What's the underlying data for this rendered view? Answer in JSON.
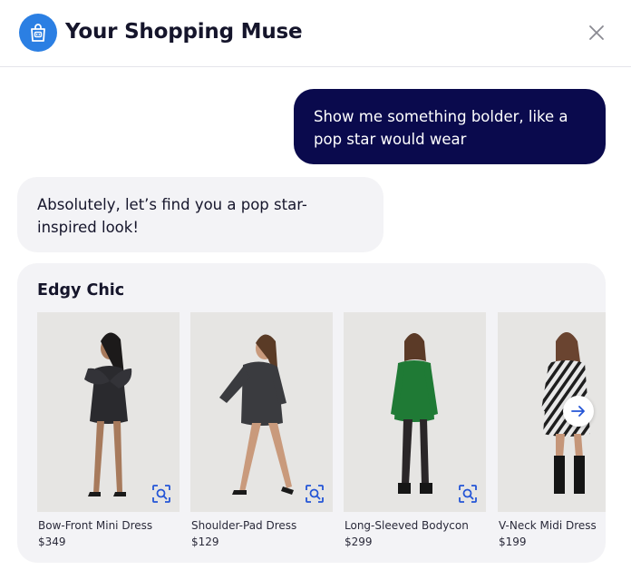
{
  "header": {
    "title": "Your Shopping Muse",
    "logo_icon": "shopping-bag-robot-icon",
    "close_icon": "close-icon",
    "brand_color": "#2b7fe3"
  },
  "chat": {
    "user_message": "Show me something bolder, like a pop star would wear",
    "bot_message": "Absolutely, let’s find you a pop star-inspired look!",
    "user_bubble_color": "#0a0a4d"
  },
  "recommendations": {
    "title": "Edgy Chic",
    "products": [
      {
        "name": "Bow-Front Mini Dress",
        "price": "$349",
        "dress_color": "#2a2a2e"
      },
      {
        "name": "Shoulder-Pad Dress",
        "price": "$129",
        "dress_color": "#3a3b3f"
      },
      {
        "name": "Long-Sleeved Bodycon",
        "price": "$299",
        "dress_color": "#1f7a35"
      },
      {
        "name": "V-Neck Midi Dress",
        "price": "$199",
        "dress_color": "#d9d9d9"
      }
    ],
    "next_icon": "arrow-right-icon",
    "visual_search_icon": "visual-search-icon"
  }
}
